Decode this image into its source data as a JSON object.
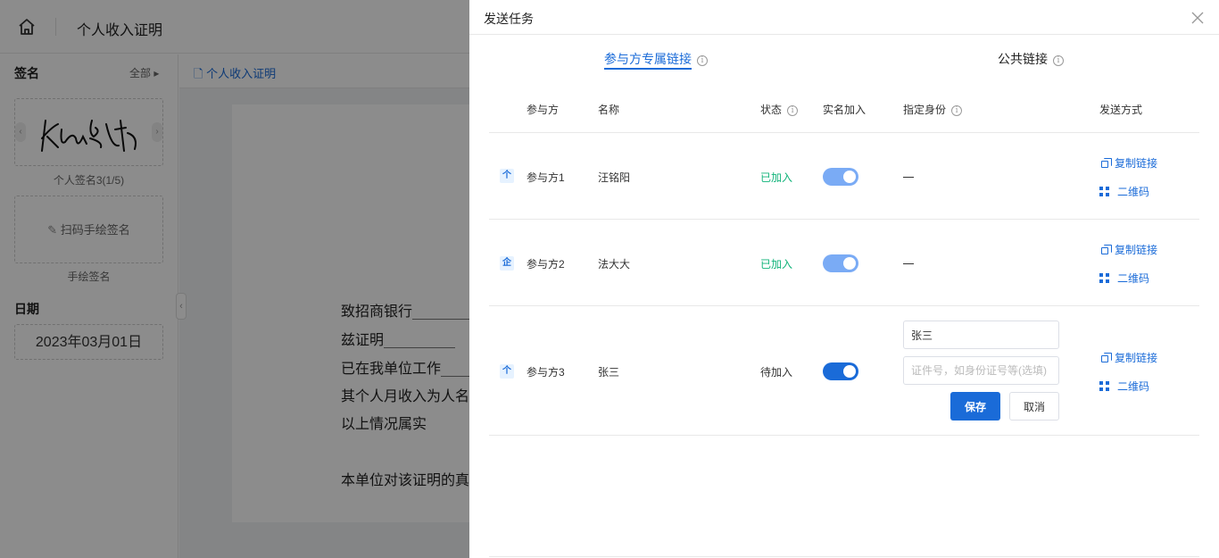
{
  "app": {
    "doc_title": "个人收入证明",
    "left": {
      "signature_section": "签名",
      "all_label": "全部 ▸",
      "signature_caption": "个人签名3(1/5)",
      "handdraw_button": "扫码手绘签名",
      "handdraw_caption": "手绘签名",
      "date_section": "日期",
      "date_value": "2023年03月01日"
    },
    "doc_tab": "个人收入证明",
    "paper_lines": [
      "致招商银行__________",
      "    兹证明__________",
      "已在我单位工作______",
      "其个人月收入为人名",
      "以上情况属实",
      "本单位对该证明的真"
    ]
  },
  "drawer": {
    "title": "发送任务",
    "tabs": [
      {
        "label": "参与方专属链接"
      },
      {
        "label": "公共链接"
      }
    ],
    "columns": {
      "party": "参与方",
      "name": "名称",
      "status": "状态",
      "realname": "实名加入",
      "identity": "指定身份",
      "send": "发送方式"
    },
    "rows": [
      {
        "icon": "个",
        "party": "参与方1",
        "name": "汪铭阳",
        "status": "已加入",
        "realname_on": true,
        "identity": "—",
        "copy": "复制链接",
        "qr": "二维码"
      },
      {
        "icon": "企",
        "party": "参与方2",
        "name": "法大大",
        "status": "已加入",
        "realname_on": true,
        "identity": "—",
        "copy": "复制链接",
        "qr": "二维码"
      },
      {
        "icon": "个",
        "party": "参与方3",
        "name": "张三",
        "status": "待加入",
        "realname_on": true,
        "copy": "复制链接",
        "qr": "二维码",
        "identity_name_value": "张三",
        "identity_id_placeholder": "证件号，如身份证号等(选填)",
        "save_label": "保存",
        "cancel_label": "取消"
      }
    ],
    "colors": {
      "accent": "#1a6bd8",
      "joined": "#12b37a"
    }
  }
}
